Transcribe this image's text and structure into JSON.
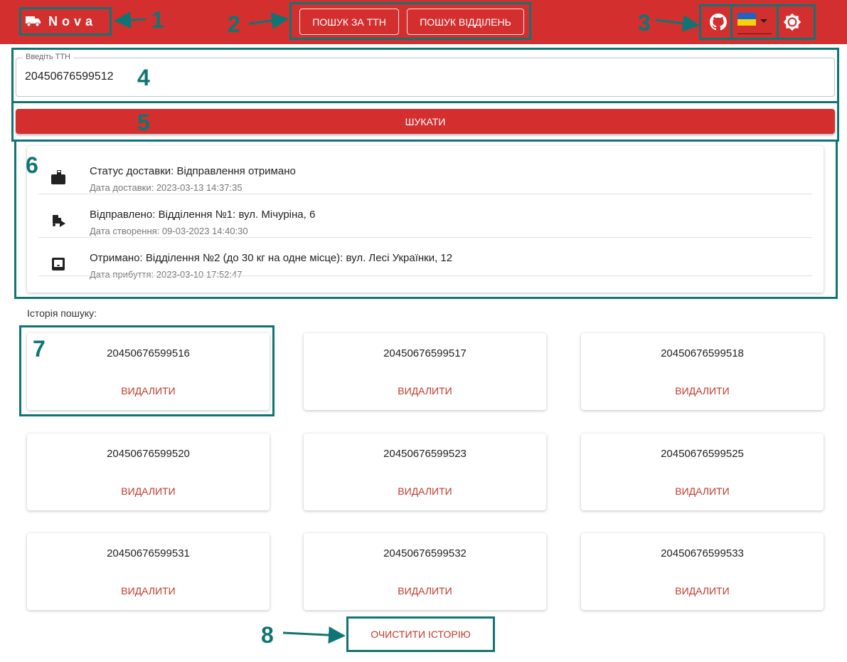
{
  "header": {
    "logo_text": "Nova",
    "nav": [
      {
        "label": "ПОШУК ЗА ТТН"
      },
      {
        "label": "ПОШУК ВІДДІЛЕНЬ"
      }
    ],
    "language": "uk",
    "colors": {
      "primary": "#d32f2f",
      "annotation": "#0f7574"
    }
  },
  "search": {
    "label": "Введіть ТТН",
    "value": "20450676599512",
    "button_label": "ШУКАТИ"
  },
  "status": {
    "items": [
      {
        "primary": "Статус доставки: Відправлення отримано",
        "secondary": "Дата доставки: 2023-03-13 14:37:35",
        "icon": "mailbox-icon"
      },
      {
        "primary": "Відправлено: Відділення №1: вул. Мічуріна, 6",
        "secondary": "Дата створення: 09-03-2023 14:40:30",
        "icon": "package-send-icon"
      },
      {
        "primary": "Отримано: Відділення №2 (до 30 кг на одне місце): вул. Лесі Українки, 12",
        "secondary": "Дата прибуття: 2023-03-10 17:52:47",
        "icon": "inbox-icon"
      }
    ]
  },
  "history": {
    "title": "Історія пошуку:",
    "delete_label": "ВИДАЛИТИ",
    "items": [
      "20450676599516",
      "20450676599517",
      "20450676599518",
      "20450676599520",
      "20450676599523",
      "20450676599525",
      "20450676599531",
      "20450676599532",
      "20450676599533"
    ],
    "clear_label": "ОЧИСТИТИ ІСТОРІЮ"
  },
  "annotations": [
    "1",
    "2",
    "3",
    "4",
    "5",
    "6",
    "7",
    "8"
  ]
}
